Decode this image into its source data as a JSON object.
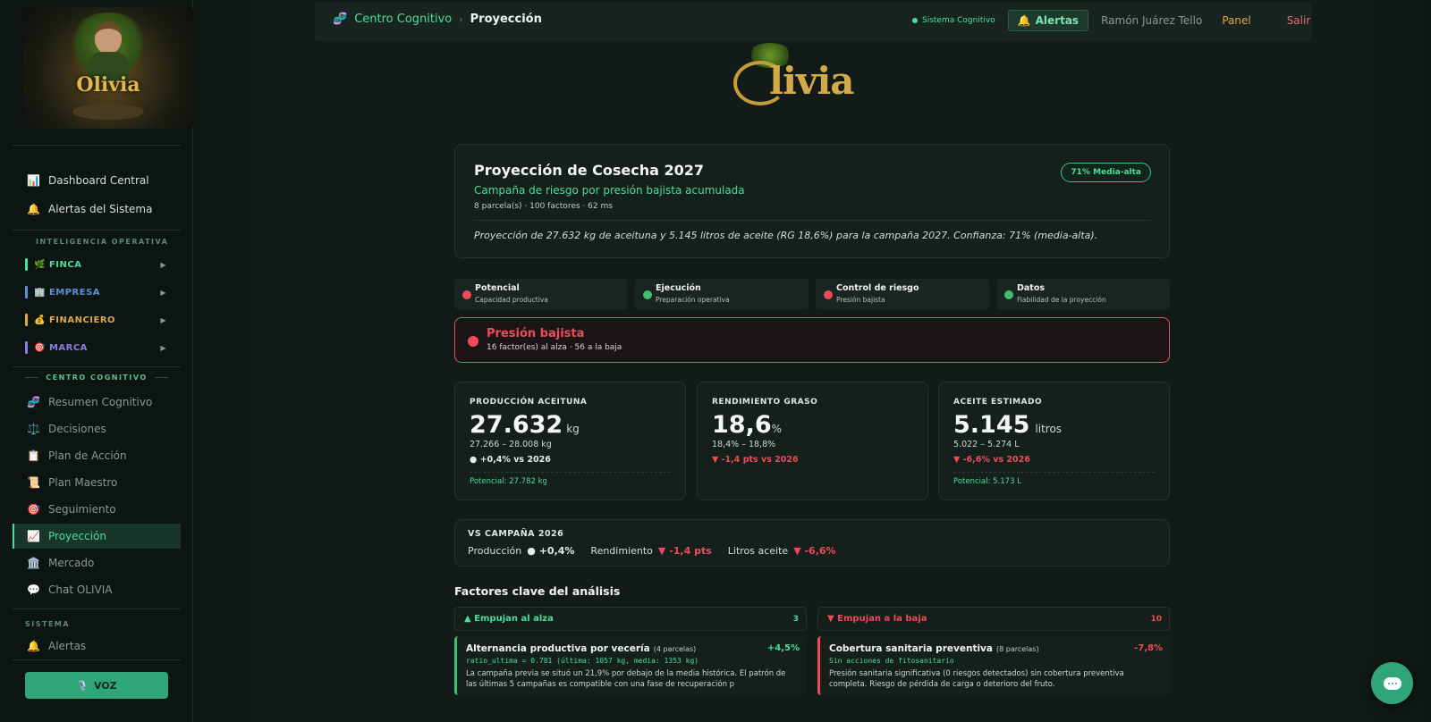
{
  "sidebar": {
    "logo_text": "Olivia",
    "nav_main": [
      {
        "icon": "📊",
        "label": "Dashboard Central"
      },
      {
        "icon": "🔔",
        "label": "Alertas del Sistema"
      }
    ],
    "section_ops": "INTELIGENCIA OPERATIVA",
    "groups": [
      {
        "icon": "🌿",
        "label": "FINCA",
        "color": "#4ade9c"
      },
      {
        "icon": "🏢",
        "label": "EMPRESA",
        "color": "#5b8fd9"
      },
      {
        "icon": "💰",
        "label": "FINANCIERO",
        "color": "#e0a64a"
      },
      {
        "icon": "🎯",
        "label": "MARCA",
        "color": "#8b7ce8"
      }
    ],
    "section_cog": "CENTRO COGNITIVO",
    "cog_items": [
      {
        "icon": "🧬",
        "label": "Resumen Cognitivo"
      },
      {
        "icon": "⚖️",
        "label": "Decisiones"
      },
      {
        "icon": "📋",
        "label": "Plan de Acción"
      },
      {
        "icon": "📜",
        "label": "Plan Maestro"
      },
      {
        "icon": "🎯",
        "label": "Seguimiento"
      },
      {
        "icon": "📈",
        "label": "Proyección"
      },
      {
        "icon": "🏛️",
        "label": "Mercado"
      },
      {
        "icon": "💬",
        "label": "Chat OLIVIA"
      }
    ],
    "section_sys": "SISTEMA",
    "sys_item": {
      "icon": "🔔",
      "label": "Alertas"
    },
    "voz_label": "VOZ",
    "voz_icon": "🎙️"
  },
  "topbar": {
    "crumb_icon": "🧬",
    "crumb_root": "Centro Cognitivo",
    "crumb_sep": "›",
    "crumb_current": "Proyección",
    "status": "Sistema Cognitivo",
    "alerts_icon": "🔔",
    "alerts": "Alertas",
    "user": "Ramón Juárez Tello",
    "panel": "Panel",
    "salir": "Salir"
  },
  "brand": {
    "word": "livia"
  },
  "hero": {
    "title": "Proyección de Cosecha 2027",
    "subtitle": "Campaña de riesgo por presión bajista acumulada",
    "meta": "8 parcela(s) · 100 factores · 62 ms",
    "pill": "71% Media-alta",
    "summary": "Proyección de 27.632 kg de aceituna y 5.145 litros de aceite (RG 18,6%) para la campaña 2027. Confianza: 71% (media-alta)."
  },
  "indicators": [
    {
      "title": "Potencial",
      "sub": "Capacidad productiva",
      "color": "#ef4a5a"
    },
    {
      "title": "Ejecución",
      "sub": "Preparación operativa",
      "color": "#3fbf6f"
    },
    {
      "title": "Control de riesgo",
      "sub": "Presión bajista",
      "color": "#ef4a5a"
    },
    {
      "title": "Datos",
      "sub": "Fiabilidad de la proyección",
      "color": "#3fbf6f"
    }
  ],
  "pressure": {
    "title": "Presión bajista",
    "sub": "16 factor(es) al alza · 56 a la baja"
  },
  "metrics": [
    {
      "label": "PRODUCCIÓN ACEITUNA",
      "value": "27.632",
      "unit": "kg",
      "range": "27.266 – 28.008 kg",
      "change": "● +0,4% vs 2026",
      "potential": "Potencial: 27.782 kg"
    },
    {
      "label": "RENDIMIENTO GRASO",
      "value": "18,6",
      "unit": "%",
      "range": "18,4% – 18,8%",
      "change": "▼ -1,4 pts vs 2026",
      "potential": ""
    },
    {
      "label": "ACEITE ESTIMADO",
      "value": "5.145",
      "unit": "litros",
      "range": "5.022 – 5.274 L",
      "change": "▼ -6,6% vs 2026",
      "potential": "Potencial: 5.173 L"
    }
  ],
  "vs": {
    "label": "VS CAMPAÑA 2026",
    "items": [
      {
        "k": "Producción",
        "v": "● +0,4%"
      },
      {
        "k": "Rendimiento",
        "v": "▼ -1,4 pts"
      },
      {
        "k": "Litros aceite",
        "v": "▼ -6,6%"
      }
    ]
  },
  "factors": {
    "title": "Factores clave del análisis",
    "up": {
      "label": "▲ Empujan al alza",
      "count": "3"
    },
    "down": {
      "label": "▼ Empujan a la baja",
      "count": "10"
    },
    "up_card": {
      "title": "Alternancia productiva por vecería",
      "parcels": "(4 parcelas)",
      "pct": "+4,5%",
      "code": "ratio_ultima = 0.781 (última: 1057 kg, media: 1353 kg)",
      "desc": "La campaña previa se situó un 21,9% por debajo de la media histórica. El patrón de las últimas 5 campañas es compatible con una fase de recuperación p"
    },
    "down_card": {
      "title": "Cobertura sanitaria preventiva",
      "parcels": "(8 parcelas)",
      "pct": "-7,8%",
      "code": "Sin acciones de fitosanitario",
      "desc": "Presión sanitaria significativa (0 riesgos detectados) sin cobertura preventiva completa. Riesgo de pérdida de carga o deterioro del fruto."
    }
  }
}
